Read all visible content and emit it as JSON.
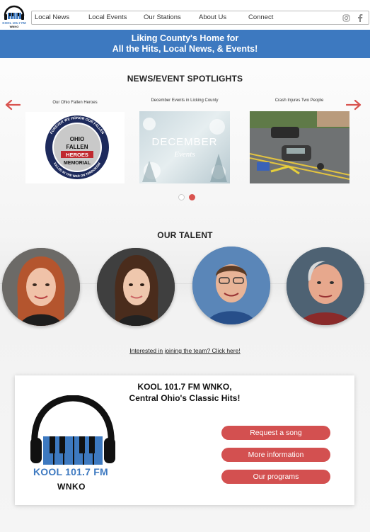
{
  "header": {
    "logo_text": "KOOL 101.7 FM",
    "logo_sub": "WNKO",
    "nav": [
      {
        "label": "Local News"
      },
      {
        "label": "Local Events"
      },
      {
        "label": "Our Stations"
      },
      {
        "label": "About Us"
      },
      {
        "label": "Connect"
      }
    ],
    "social_icons": [
      "instagram-icon",
      "facebook-icon"
    ]
  },
  "banner": {
    "line1": "Liking County's Home for",
    "line2": "All the Hits, Local News, & Events!"
  },
  "spotlights": {
    "title": "NEWS/EVENT SPOTLIGHTS",
    "cards": [
      {
        "caption": "Our Ohio Fallen Heroes",
        "badge_top": "OHIO",
        "badge_mid": "FALLEN",
        "badge_heroes": "HEROES",
        "badge_memorial": "MEMORIAL",
        "ring_top": "FOREVER WE HONOR OUR FALLEN",
        "ring_bottom": "KILLED IN THE WAR ON TERRORISM"
      },
      {
        "caption": "December Events in Licking County",
        "image_title": "DECEMBER",
        "image_sub": "Events"
      },
      {
        "caption": "Crash Injures Two People"
      }
    ],
    "dots": 2,
    "active_dot": 2
  },
  "talent": {
    "title": "OUR TALENT",
    "people": 4,
    "join_link": "Interested in joining the team? Click here!"
  },
  "station": {
    "title_line1": "KOOL 101.7 FM WNKO,",
    "title_line2": "Central Ohio's Classic Hits!",
    "brand_line1": "KOOL 101.7 FM",
    "brand_line2": "WNKO",
    "buttons": [
      {
        "label": "Request a song"
      },
      {
        "label": "More information"
      },
      {
        "label": "Our programs"
      }
    ]
  },
  "colors": {
    "accent_blue": "#3d79c0",
    "accent_red": "#d35050"
  }
}
